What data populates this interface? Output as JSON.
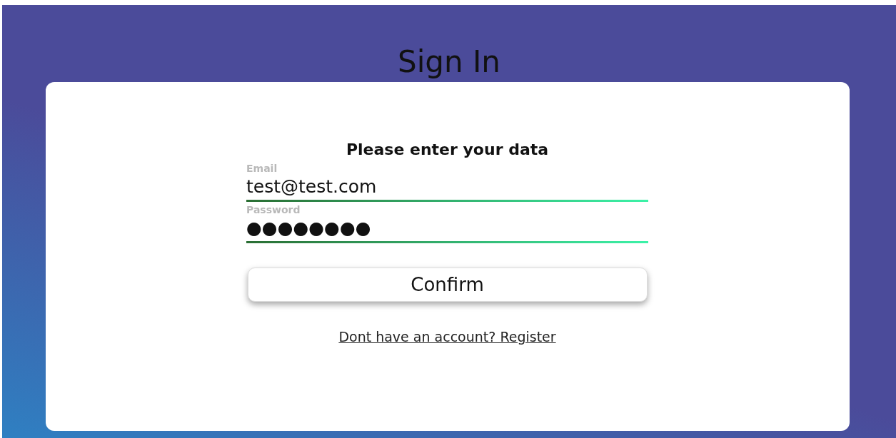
{
  "title": "Sign In",
  "form": {
    "heading": "Please enter your data",
    "fields": [
      {
        "label": "Email",
        "value": "test@test.com"
      },
      {
        "label": "Password",
        "value": "●●●●●●●●"
      }
    ],
    "button": "Confirm",
    "link": "Dont have an account? Register"
  }
}
